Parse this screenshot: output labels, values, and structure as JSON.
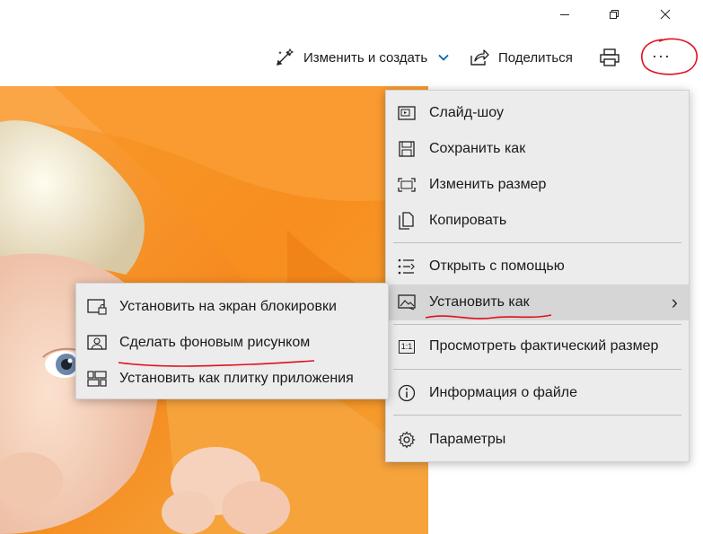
{
  "window": {
    "minimize_icon": "minimize-icon",
    "restore_icon": "restore-icon",
    "close_icon": "close-icon"
  },
  "toolbar": {
    "edit_create_label": "Изменить и создать",
    "share_label": "Поделиться",
    "print_icon": "printer-icon",
    "more_label": "···"
  },
  "menu": {
    "items": [
      {
        "label": "Слайд-шоу",
        "icon": "slideshow-icon"
      },
      {
        "label": "Сохранить как",
        "icon": "save-icon"
      },
      {
        "label": "Изменить размер",
        "icon": "resize-icon"
      },
      {
        "label": "Копировать",
        "icon": "copy-icon"
      },
      {
        "label": "Открыть с помощью",
        "icon": "open-with-icon"
      },
      {
        "label": "Установить как",
        "icon": "set-as-icon",
        "submenu_arrow": "›"
      },
      {
        "label": "Просмотреть фактический размер",
        "icon": "actual-size-icon",
        "icon_text": "1:1"
      },
      {
        "label": "Информация о файле",
        "icon": "info-icon"
      },
      {
        "label": "Параметры",
        "icon": "settings-icon"
      }
    ]
  },
  "submenu": {
    "items": [
      {
        "label": "Установить на экран блокировки",
        "icon": "lock-screen-icon"
      },
      {
        "label": "Сделать фоновым рисунком",
        "icon": "wallpaper-icon"
      },
      {
        "label": "Установить как плитку приложения",
        "icon": "app-tile-icon"
      }
    ]
  },
  "colors": {
    "accent": "#0063b1",
    "annotation": "#e0101c",
    "menu_bg": "#ececec",
    "menu_highlight": "#d6d6d6"
  }
}
